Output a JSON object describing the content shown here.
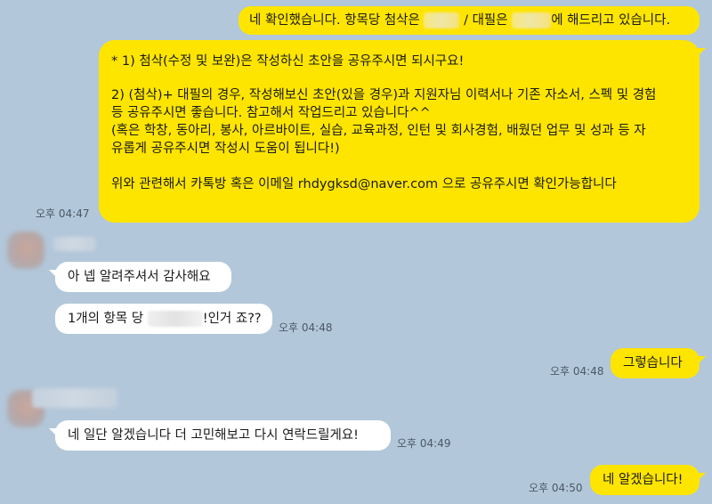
{
  "messages": {
    "m1": {
      "before": "네 확인했습니다. 항목당 첨삭은",
      "middle": "/ 대필은",
      "after": "에 해드리고 있습니다."
    },
    "m2": {
      "line1": "* 1) 첨삭(수정 및 보완)은 작성하신 초안을 공유주시면 되시구요!",
      "line2": "2) (첨삭)+ 대필의 경우, 작성해보신 초안(있을 경우)과 지원자님 이력서나 기존 자소서, 스펙 및 경험",
      "line3": "등 공유주시면 좋습니다. 참고해서 작업드리고 있습니다^^",
      "line4": "(혹은 학창, 동아리, 봉사, 아르바이트, 실습, 교육과정, 인턴 및 회사경험, 배웠던 업무 및 성과 등 자",
      "line5": "유롭게 공유주시면 작성시 도움이 됩니다!)",
      "line6": "위와 관련해서 카톡방 혹은 이메일 rhdygksd@naver.com 으로 공유주시면 확인가능합니다",
      "time": "오후 04:47"
    },
    "m3": {
      "text": "아 넵 알려주셔서 감사해요"
    },
    "m4": {
      "before": "1개의 항목 당",
      "after": "!인거 죠??",
      "time": "오후 04:48"
    },
    "m5": {
      "text": "그렇습니다",
      "time": "오후 04:48"
    },
    "m6": {
      "text": "네 일단 알겠습니다 더 고민해보고 다시 연락드릴게요!",
      "time": "오후 04:49"
    },
    "m7": {
      "text": "네 알겠습니다!",
      "time": "오후 04:50"
    }
  },
  "colors": {
    "background": "#b2c7da",
    "my_bubble": "#fee500",
    "their_bubble": "#ffffff",
    "time_text": "#4b5866"
  }
}
